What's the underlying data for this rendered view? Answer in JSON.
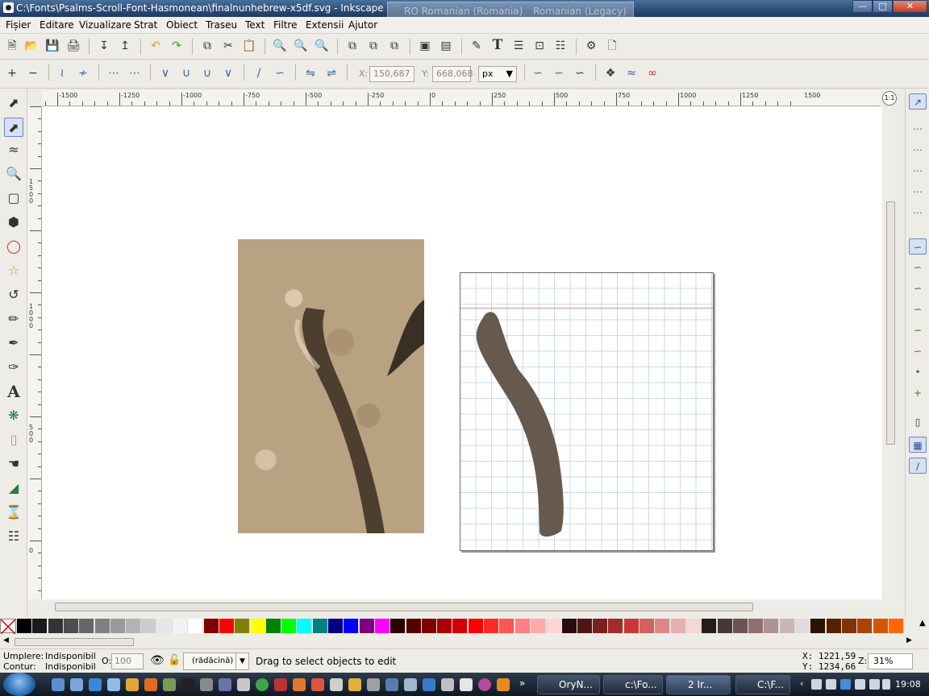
{
  "window": {
    "title": "C:\\Fonts\\Psalms-Scroll-Font-Hasmonean\\finalnunhebrew-x5df.svg - Inkscape",
    "lang_bar": [
      "RO Romanian (Romania)",
      "Romanian (Legacy)"
    ]
  },
  "menu": [
    "Fișier",
    "Editare",
    "Vizualizare",
    "Strat",
    "Obiect",
    "Traseu",
    "Text",
    "Filtre",
    "Extensii",
    "Ajutor"
  ],
  "node_controls": {
    "x_label": "X:",
    "x_value": "150,687",
    "y_label": "Y:",
    "y_value": "668,068",
    "unit": "px"
  },
  "ruler": {
    "h_labels": [
      "-1500",
      "-1250",
      "-1000",
      "-750",
      "-500",
      "-250",
      "0",
      "250",
      "500",
      "750",
      "1000",
      "1250",
      "1500"
    ],
    "v_labels": [
      "1500",
      "1000",
      "500",
      "0"
    ]
  },
  "canvas": {
    "glyph_color": "#665a4e",
    "guide_color": "#e29090",
    "grid_color": "#c8dbe3"
  },
  "palette": [
    "#000000",
    "#1a1a1a",
    "#333333",
    "#4d4d4d",
    "#666666",
    "#808080",
    "#999999",
    "#b3b3b3",
    "#cccccc",
    "#e6e6e6",
    "#f2f2f2",
    "#ffffff",
    "#800000",
    "#ff0000",
    "#808000",
    "#ffff00",
    "#008000",
    "#00ff00",
    "#00ffff",
    "#008080",
    "#000080",
    "#0000ff",
    "#800080",
    "#ff00ff",
    "#2b0000",
    "#550000",
    "#800000",
    "#aa0000",
    "#d40000",
    "#ff0000",
    "#ff2a2a",
    "#ff5555",
    "#ff8080",
    "#ffaaaa",
    "#ffd5d5",
    "#280b0b",
    "#501616",
    "#782121",
    "#a02c2c",
    "#c83737",
    "#d35f5f",
    "#de8787",
    "#e9afaf",
    "#f4d7d7",
    "#241c1c",
    "#483737",
    "#6c5353",
    "#916f6f",
    "#ac9393",
    "#c8b7b7",
    "#e3dbdb",
    "#2b1100",
    "#552200",
    "#803300",
    "#aa4400",
    "#d45500",
    "#ff6600"
  ],
  "status": {
    "fill_label": "Umplere:",
    "fill_value": "Indisponibil",
    "stroke_label": "Contur:",
    "stroke_value": "Indisponibil",
    "opacity_label": "O:",
    "opacity_value": "100",
    "layer": "(rădăcină)",
    "message": "Drag to select objects to edit",
    "cursor_x": "X: 1221,59",
    "cursor_y": "Y: 1234,66",
    "zoom_label": "Z:",
    "zoom_value": "31%"
  },
  "taskbar": {
    "tasks": [
      "OryN...",
      "c:\\Fo...",
      "2 Ir...",
      "C:\\F..."
    ],
    "clock": "19:08"
  }
}
